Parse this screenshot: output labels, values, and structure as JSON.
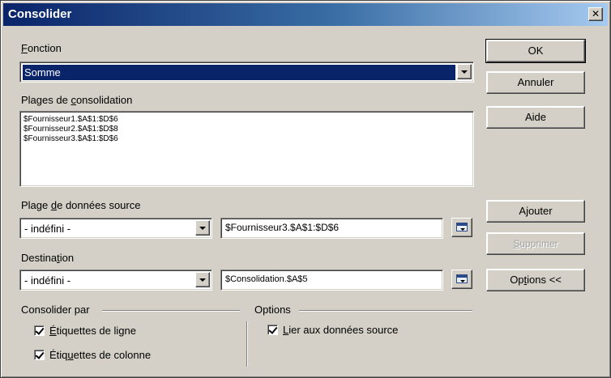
{
  "window": {
    "title": "Consolider",
    "close_glyph": "✕"
  },
  "fonction": {
    "label_accel": "F",
    "label_rest": "onction",
    "value": "Somme"
  },
  "plages": {
    "label_pre": "Plages de ",
    "label_accel": "c",
    "label_post": "onsolidation",
    "items": [
      "$Fournisseur1.$A$1:$D$6",
      "$Fournisseur2.$A$1:$D$8",
      "$Fournisseur3.$A$1:$D$6"
    ]
  },
  "source": {
    "label_pre": "Plage ",
    "label_accel": "d",
    "label_post": "e données source",
    "combo_value": "- indéfini -",
    "field_value": "$Fournisseur3.$A$1:$D$6"
  },
  "destination": {
    "label_pre": "Destina",
    "label_accel": "t",
    "label_post": "ion",
    "combo_value": "- indéfini -",
    "field_value": "$Consolidation.$A$5"
  },
  "buttons": {
    "ok": "OK",
    "annuler": "Annuler",
    "aide": "Aide",
    "ajouter_pre": "A",
    "ajouter_accel": "j",
    "ajouter_post": "outer",
    "supprimer_accel": "S",
    "supprimer_post": "upprimer",
    "options_pre": "Op",
    "options_accel": "t",
    "options_post": "ions <<"
  },
  "consolider_par": {
    "label": "Consolider par",
    "row_labels_accel": "É",
    "row_labels_post": "tiquettes de ligne",
    "row_labels_checked": true,
    "col_labels_pre": "Étiq",
    "col_labels_accel": "u",
    "col_labels_post": "ettes de colonne",
    "col_labels_checked": true
  },
  "options": {
    "label": "Options",
    "link_accel": "L",
    "link_post": "ier aux données source",
    "link_checked": true
  },
  "colors": {
    "face": "#d4d0c8",
    "title_start": "#0a246a",
    "title_end": "#a6caf0",
    "selection": "#0a246a"
  }
}
